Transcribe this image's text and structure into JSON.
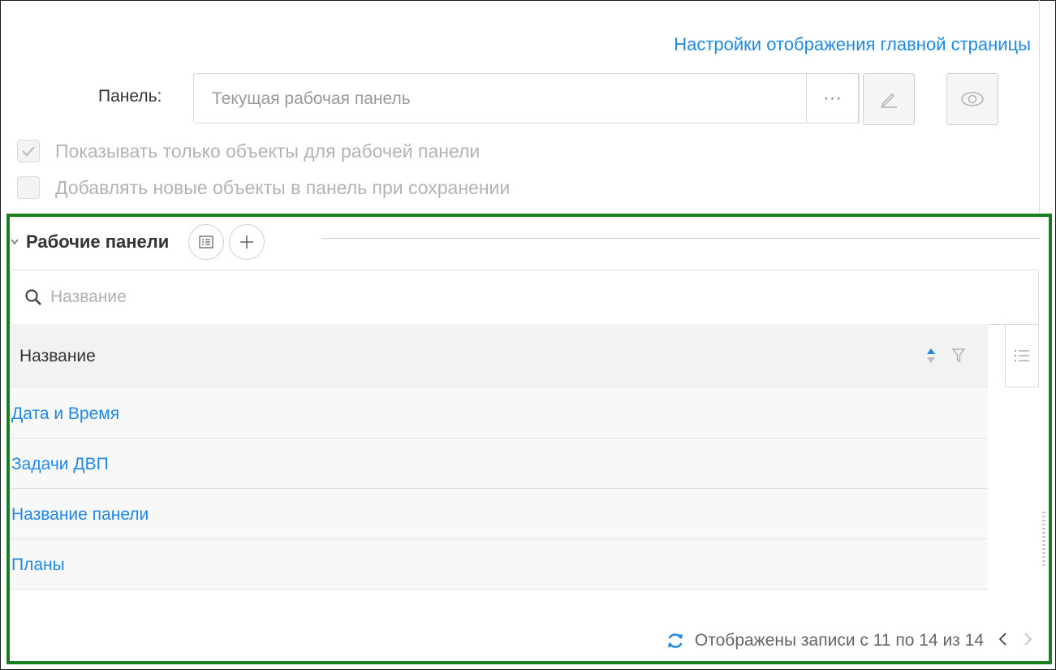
{
  "settings_link": "Настройки отображения главной страницы",
  "panel": {
    "label": "Панель:",
    "placeholder": "Текущая рабочая панель",
    "dots": "···"
  },
  "checkboxes": [
    {
      "label": "Показывать только объекты для рабочей панели",
      "checked": true
    },
    {
      "label": "Добавлять новые объекты в панель при сохранении",
      "checked": false
    }
  ],
  "section": {
    "title": "Рабочие панели",
    "search_placeholder": "Название",
    "column_header": "Название",
    "rows": [
      "Дата и Время",
      "Задачи ДВП",
      "Название панели",
      "Планы"
    ],
    "pagination": "Отображены записи с 11 по 14 из 14"
  },
  "colors": {
    "accent": "#1e88e5",
    "highlight_border": "#16801a"
  },
  "icons": [
    "chevron-down-icon",
    "list-view-icon",
    "plus-icon",
    "search-icon",
    "sort-icon",
    "filter-icon",
    "column-menu-icon",
    "refresh-icon",
    "pencil-icon",
    "eye-icon",
    "check-icon",
    "prev-page-icon",
    "next-page-icon"
  ]
}
